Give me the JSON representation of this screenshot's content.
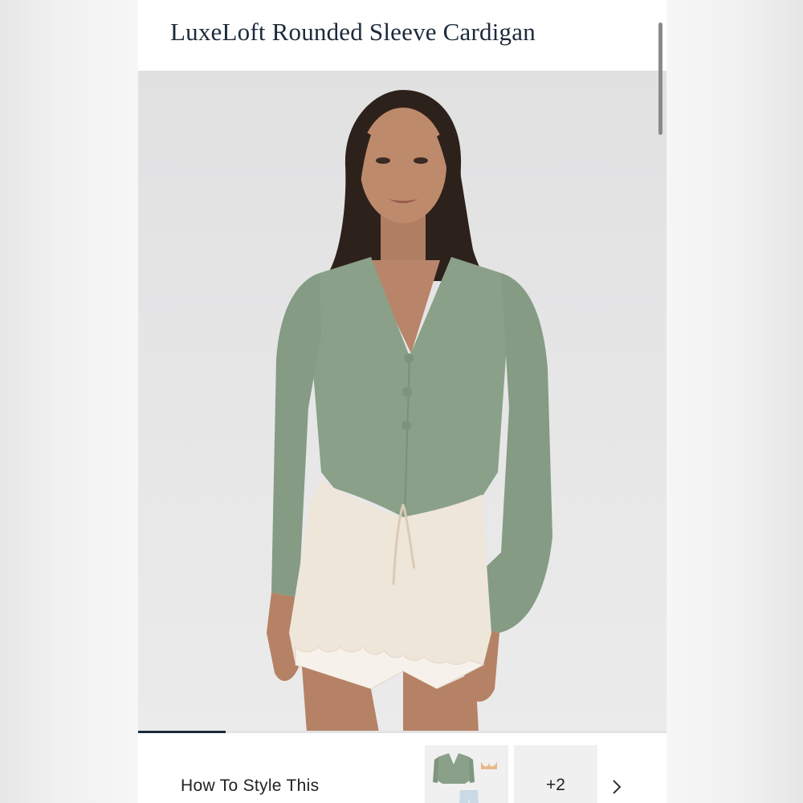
{
  "product": {
    "title": "LuxeLoft Rounded Sleeve Cardigan"
  },
  "gallery": {
    "image_alt": "Model wearing a sage green cropped button-front cardigan with cream satin lace-trim shorts",
    "progress": 0.166
  },
  "style_section": {
    "label": "How To Style This",
    "outfit_thumbnail_alt": "Outfit pieces: green cardigan, bralette, light jeans",
    "more_count": "+2",
    "next_icon": "chevron-right-icon"
  },
  "colors": {
    "title_text": "#1d2a3a",
    "cardigan": "#8aa089",
    "shorts": "#efe6da",
    "progress": "#1d2a3a"
  }
}
